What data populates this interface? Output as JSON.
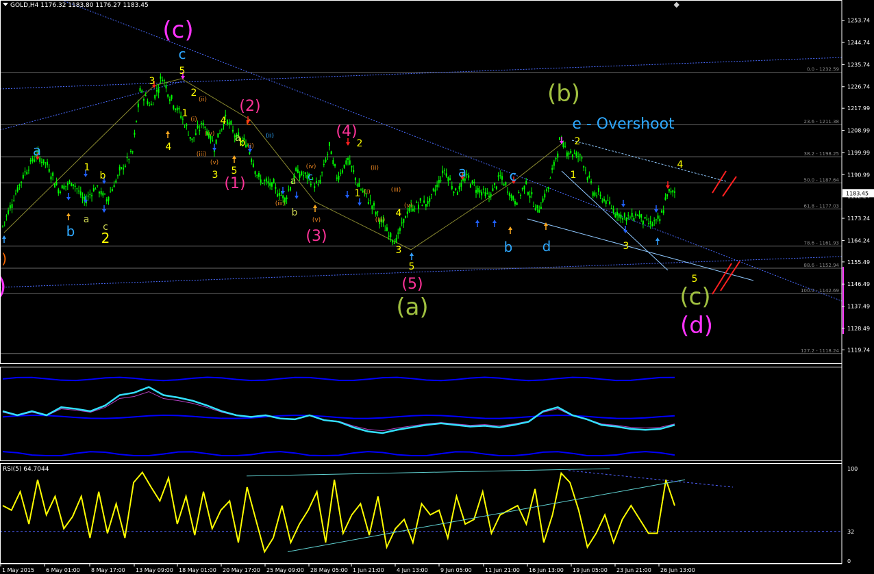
{
  "window": {
    "symbol_header": "GOLD,H4  1176.32 1183.80 1176.27 1183.45",
    "rsi_header": "RSI(5) 64.7044"
  },
  "colors": {
    "background": "#000000",
    "grid": "#ffffff",
    "candles": "#00ff00",
    "rsi_line": "#ffff00",
    "bands": "#0000ff",
    "indicator_line": "#33e0ff",
    "fib_lines": "#808080",
    "trendline": "#4a6bff"
  },
  "chart_data": [
    {
      "type": "candlestick",
      "title": "GOLD,H4",
      "ohlc_last": {
        "open": 1176.32,
        "high": 1183.8,
        "low": 1176.27,
        "close": 1183.45
      },
      "current_price_label": "1183.45",
      "ylim": [
        1114.0,
        1262.0
      ],
      "y_ticks": [
        "1253.74",
        "1244.74",
        "1235.74",
        "1226.74",
        "1217.99",
        "1208.99",
        "1199.99",
        "1190.99",
        "1182.24",
        "1173.24",
        "1164.24",
        "1155.49",
        "1146.49",
        "1137.49",
        "1128.49",
        "1119.74"
      ],
      "x_ticks": [
        "1 May 2015",
        "6 May 01:00",
        "8 May 17:00",
        "13 May 09:00",
        "18 May 01:00",
        "20 May 17:00",
        "25 May 09:00",
        "28 May 05:00",
        "1 Jun 21:00",
        "4 Jun 13:00",
        "9 Jun 05:00",
        "11 Jun 21:00",
        "16 Jun 13:00",
        "19 Jun 05:00",
        "23 Jun 21:00",
        "26 Jun 13:00"
      ],
      "price_path": [
        [
          0,
          1170
        ],
        [
          5,
          1180
        ],
        [
          12,
          1192
        ],
        [
          18,
          1199
        ],
        [
          24,
          1195
        ],
        [
          30,
          1185
        ],
        [
          38,
          1188
        ],
        [
          44,
          1180
        ],
        [
          50,
          1186
        ],
        [
          56,
          1181
        ],
        [
          64,
          1193
        ],
        [
          70,
          1200
        ],
        [
          74,
          1225
        ],
        [
          80,
          1219
        ],
        [
          86,
          1231
        ],
        [
          90,
          1223
        ],
        [
          96,
          1215
        ],
        [
          102,
          1205
        ],
        [
          108,
          1212
        ],
        [
          114,
          1203
        ],
        [
          120,
          1214
        ],
        [
          126,
          1206
        ],
        [
          132,
          1203
        ],
        [
          138,
          1189
        ],
        [
          146,
          1186
        ],
        [
          152,
          1181
        ],
        [
          158,
          1192
        ],
        [
          164,
          1190
        ],
        [
          170,
          1186
        ],
        [
          176,
          1202
        ],
        [
          180,
          1190
        ],
        [
          186,
          1197
        ],
        [
          192,
          1186
        ],
        [
          198,
          1180
        ],
        [
          206,
          1169
        ],
        [
          212,
          1164
        ],
        [
          218,
          1176
        ],
        [
          224,
          1179
        ],
        [
          230,
          1180
        ],
        [
          238,
          1193
        ],
        [
          244,
          1184
        ],
        [
          250,
          1190
        ],
        [
          256,
          1185
        ],
        [
          262,
          1182
        ],
        [
          268,
          1190
        ],
        [
          276,
          1180
        ],
        [
          282,
          1187
        ],
        [
          288,
          1176
        ],
        [
          294,
          1186
        ],
        [
          300,
          1204
        ],
        [
          306,
          1200
        ],
        [
          312,
          1198
        ],
        [
          318,
          1184
        ],
        [
          324,
          1181
        ],
        [
          330,
          1176
        ],
        [
          336,
          1173
        ],
        [
          342,
          1175
        ],
        [
          348,
          1171
        ],
        [
          354,
          1172
        ],
        [
          358,
          1183
        ],
        [
          362,
          1184
        ]
      ],
      "fibonacci_levels": [
        {
          "label": "0.0 - 1232.59",
          "price": 1232.59
        },
        {
          "label": "23.6 - 1211.38",
          "price": 1211.38
        },
        {
          "label": "38.2 - 1198.25",
          "price": 1198.25
        },
        {
          "label": "50.0 - 1187.64",
          "price": 1187.64
        },
        {
          "label": "61.8 - 1177.03",
          "price": 1177.03
        },
        {
          "label": "78.6 - 1161.93",
          "price": 1161.93
        },
        {
          "label": "88.6 - 1152.94",
          "price": 1152.94
        },
        {
          "label": "100.0 - 1142.69",
          "price": 1142.69
        },
        {
          "label": "127.2 - 1118.24",
          "price": 1118.24
        }
      ],
      "wave_labels": [
        {
          "text": "(c)",
          "color": "#ff33ff",
          "size": "xl"
        },
        {
          "text": "c",
          "color": "#2ea8ff",
          "size": "m"
        },
        {
          "text": "5",
          "color": "#ffff00",
          "size": "s"
        },
        {
          "text": "3",
          "color": "#ffff00",
          "size": "s"
        },
        {
          "text": "2",
          "color": "#ffff00",
          "size": "s"
        },
        {
          "text": "1",
          "color": "#ffff00",
          "size": "s"
        },
        {
          "text": "4",
          "color": "#ffff00",
          "size": "s"
        },
        {
          "text": "a",
          "color": "#2ea8ff",
          "size": "m"
        },
        {
          "text": "1",
          "color": "#ffff00",
          "size": "s"
        },
        {
          "text": "b",
          "color": "#ffff00",
          "size": "s"
        },
        {
          "text": "b",
          "color": "#2ea8ff",
          "size": "m"
        },
        {
          "text": "a",
          "color": "#c8d050",
          "size": "s"
        },
        {
          "text": "c",
          "color": "#c8d050",
          "size": "s"
        },
        {
          "text": "2",
          "color": "#ffff00",
          "size": "m"
        },
        {
          "text": "e)",
          "color": "#ff6a00",
          "size": "m"
        },
        {
          "text": "b)",
          "color": "#ff33ff",
          "size": "xl"
        },
        {
          "text": "(ii)",
          "color": "#e08020",
          "size": "xs"
        },
        {
          "text": "(i)",
          "color": "#e08020",
          "size": "xs"
        },
        {
          "text": "(iii)",
          "color": "#e08020",
          "size": "xs"
        },
        {
          "text": "(iv)",
          "color": "#e08020",
          "size": "xs"
        },
        {
          "text": "(v)",
          "color": "#e08020",
          "size": "xs"
        },
        {
          "text": "4",
          "color": "#ffff00",
          "size": "s"
        },
        {
          "text": "a",
          "color": "#c8d050",
          "size": "s"
        },
        {
          "text": "b",
          "color": "#ffff00",
          "size": "s"
        },
        {
          "text": "3",
          "color": "#ffff00",
          "size": "s"
        },
        {
          "text": "5",
          "color": "#ffff00",
          "size": "s"
        },
        {
          "text": "(i)",
          "color": "#e08020",
          "size": "xs"
        },
        {
          "text": "(1)",
          "color": "#ff3399",
          "size": "l"
        },
        {
          "text": "(2)",
          "color": "#ff3399",
          "size": "l"
        },
        {
          "text": "c",
          "color": "#ff6a00",
          "size": "s"
        },
        {
          "text": "(ii)",
          "color": "#2ea8ff",
          "size": "xs"
        },
        {
          "text": "a",
          "color": "#c8d050",
          "size": "s"
        },
        {
          "text": "c",
          "color": "#2ea8ff",
          "size": "s"
        },
        {
          "text": "(iii)",
          "color": "#e08020",
          "size": "xs"
        },
        {
          "text": "b",
          "color": "#c8d050",
          "size": "s"
        },
        {
          "text": "(iv)",
          "color": "#e08020",
          "size": "xs"
        },
        {
          "text": "(v)",
          "color": "#e08020",
          "size": "xs"
        },
        {
          "text": "(3)",
          "color": "#ff3399",
          "size": "l"
        },
        {
          "text": "(4)",
          "color": "#ff3399",
          "size": "l"
        },
        {
          "text": "2",
          "color": "#ffff00",
          "size": "s"
        },
        {
          "text": "(ii)",
          "color": "#e08020",
          "size": "xs"
        },
        {
          "text": "(i)",
          "color": "#e08020",
          "size": "xs"
        },
        {
          "text": "1",
          "color": "#ffff00",
          "size": "s"
        },
        {
          "text": "(iii)",
          "color": "#e08020",
          "size": "xs"
        },
        {
          "text": "(iii)",
          "color": "#e08020",
          "size": "xs"
        },
        {
          "text": "4",
          "color": "#ffff00",
          "size": "s"
        },
        {
          "text": "(v)",
          "color": "#e08020",
          "size": "xs"
        },
        {
          "text": "3",
          "color": "#ffff00",
          "size": "s"
        },
        {
          "text": "5",
          "color": "#ffff00",
          "size": "s"
        },
        {
          "text": "(5)",
          "color": "#ff3399",
          "size": "l"
        },
        {
          "text": "(a)",
          "color": "#a0c040",
          "size": "xl"
        },
        {
          "text": "a",
          "color": "#2ea8ff",
          "size": "m"
        },
        {
          "text": "c",
          "color": "#2ea8ff",
          "size": "m"
        },
        {
          "text": "b",
          "color": "#2ea8ff",
          "size": "m"
        },
        {
          "text": "d",
          "color": "#2ea8ff",
          "size": "m"
        },
        {
          "text": "(b)",
          "color": "#a0c040",
          "size": "xl"
        },
        {
          "text": "e - Overshoot",
          "color": "#2ea8ff",
          "size": "l"
        },
        {
          "text": "2",
          "color": "#ffff00",
          "size": "s"
        },
        {
          "text": "1",
          "color": "#ffff00",
          "size": "s"
        },
        {
          "text": "3",
          "color": "#ffff00",
          "size": "s"
        },
        {
          "text": "4",
          "color": "#ffff00",
          "size": "s"
        },
        {
          "text": "5",
          "color": "#ffff00",
          "size": "s"
        },
        {
          "text": "(c)",
          "color": "#a0c040",
          "size": "xl"
        },
        {
          "text": "(d)",
          "color": "#ff33ff",
          "size": "xl"
        }
      ]
    },
    {
      "type": "line",
      "indicator": "bands",
      "series_main": [
        0.55,
        0.5,
        0.55,
        0.5,
        0.6,
        0.58,
        0.55,
        0.62,
        0.75,
        0.78,
        0.85,
        0.75,
        0.72,
        0.68,
        0.62,
        0.55,
        0.5,
        0.48,
        0.5,
        0.46,
        0.45,
        0.5,
        0.44,
        0.42,
        0.35,
        0.3,
        0.28,
        0.32,
        0.35,
        0.38,
        0.4,
        0.38,
        0.36,
        0.37,
        0.35,
        0.38,
        0.42,
        0.55,
        0.6,
        0.5,
        0.45,
        0.38,
        0.36,
        0.33,
        0.32,
        0.33,
        0.38
      ]
    },
    {
      "type": "line",
      "title": "RSI(5) 64.7044",
      "ylim": [
        0,
        100
      ],
      "y_ticks": [
        "100",
        "32",
        "0"
      ],
      "values": [
        60,
        55,
        75,
        40,
        88,
        50,
        70,
        35,
        48,
        70,
        25,
        75,
        30,
        62,
        25,
        85,
        96,
        80,
        65,
        90,
        40,
        70,
        28,
        75,
        35,
        55,
        65,
        20,
        80,
        45,
        10,
        25,
        60,
        20,
        40,
        55,
        75,
        20,
        88,
        30,
        50,
        62,
        28,
        70,
        15,
        35,
        45,
        20,
        62,
        50,
        55,
        25,
        70,
        40,
        45,
        75,
        30,
        50,
        55,
        60,
        40,
        78,
        20,
        50,
        95,
        85,
        55,
        15,
        30,
        50,
        20,
        45,
        60,
        45,
        30,
        30,
        88,
        60
      ]
    }
  ]
}
